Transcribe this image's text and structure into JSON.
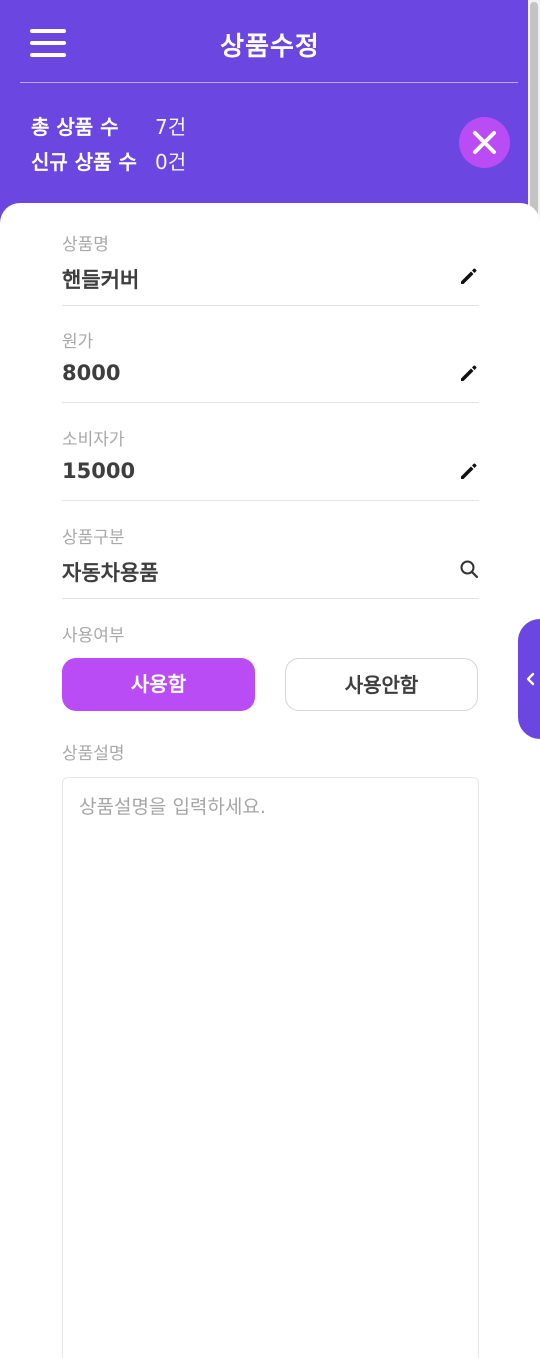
{
  "header": {
    "title": "상품수정",
    "stats": [
      {
        "label": "총 상품 수",
        "value": "7건"
      },
      {
        "label": "신규 상품 수",
        "value": "0건"
      }
    ]
  },
  "form": {
    "product_name": {
      "label": "상품명",
      "value": "핸들커버",
      "icon": "pencil-icon"
    },
    "cost_price": {
      "label": "원가",
      "value": "8000",
      "icon": "pencil-icon"
    },
    "retail_price": {
      "label": "소비자가",
      "value": "15000",
      "icon": "pencil-icon"
    },
    "category": {
      "label": "상품구분",
      "value": "자동차용품",
      "icon": "search-icon"
    },
    "usage": {
      "label": "사용여부",
      "options": [
        "사용함",
        "사용안함"
      ],
      "selected": "사용함"
    },
    "description": {
      "label": "상품설명",
      "value": "",
      "placeholder": "상품설명을 입력하세요."
    }
  },
  "colors": {
    "primary": "#6b46e0",
    "accent": "#b94cf5",
    "label_gray": "#a8a8a8",
    "text_dark": "#3e3e3e"
  }
}
